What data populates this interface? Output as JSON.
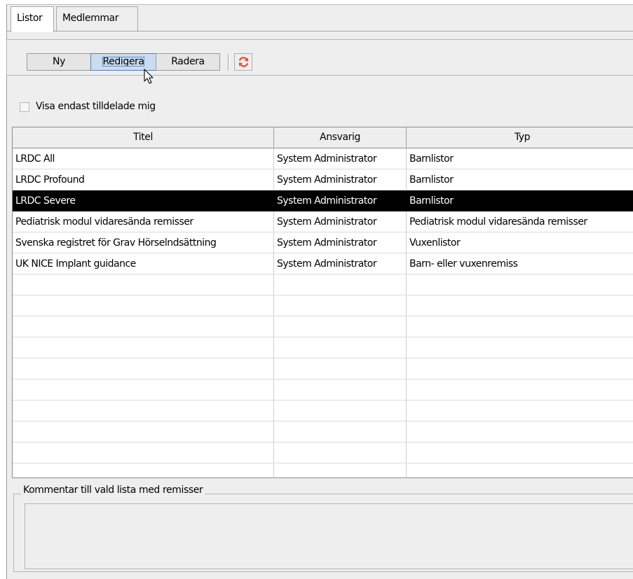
{
  "tabs": [
    {
      "label": "Listor",
      "active": true
    },
    {
      "label": "Medlemmar",
      "active": false
    }
  ],
  "toolbar": {
    "new_label": "Ny",
    "edit_label": "Redigera",
    "delete_label": "Radera",
    "refresh_icon": "refresh-icon",
    "refresh_color": "#e8502a"
  },
  "filter": {
    "checkbox_label": "Visa endast tilldelade mig",
    "checked": false
  },
  "table": {
    "columns": [
      "Titel",
      "Ansvarig",
      "Typ"
    ],
    "rows": [
      [
        "LRDC All",
        "System Administrator",
        "Barnlistor"
      ],
      [
        "LRDC Profound",
        "System Administrator",
        "Barnlistor"
      ],
      [
        "LRDC Severe",
        "System Administrator",
        "Barnlistor"
      ],
      [
        "Pediatrisk modul vidaresända remisser",
        "System Administrator",
        "Pediatrisk modul vidaresända remisser"
      ],
      [
        "Svenska registret för Grav Hörselndsättning",
        "System Administrator",
        "Vuxenlistor"
      ],
      [
        "UK NICE Implant guidance",
        "System Administrator",
        "Barn- eller vuxenremiss"
      ]
    ],
    "selected_row": 2,
    "selected_color": "#000000"
  },
  "comment": {
    "title": "Kommentar till vald lista med remisser",
    "value": ""
  }
}
